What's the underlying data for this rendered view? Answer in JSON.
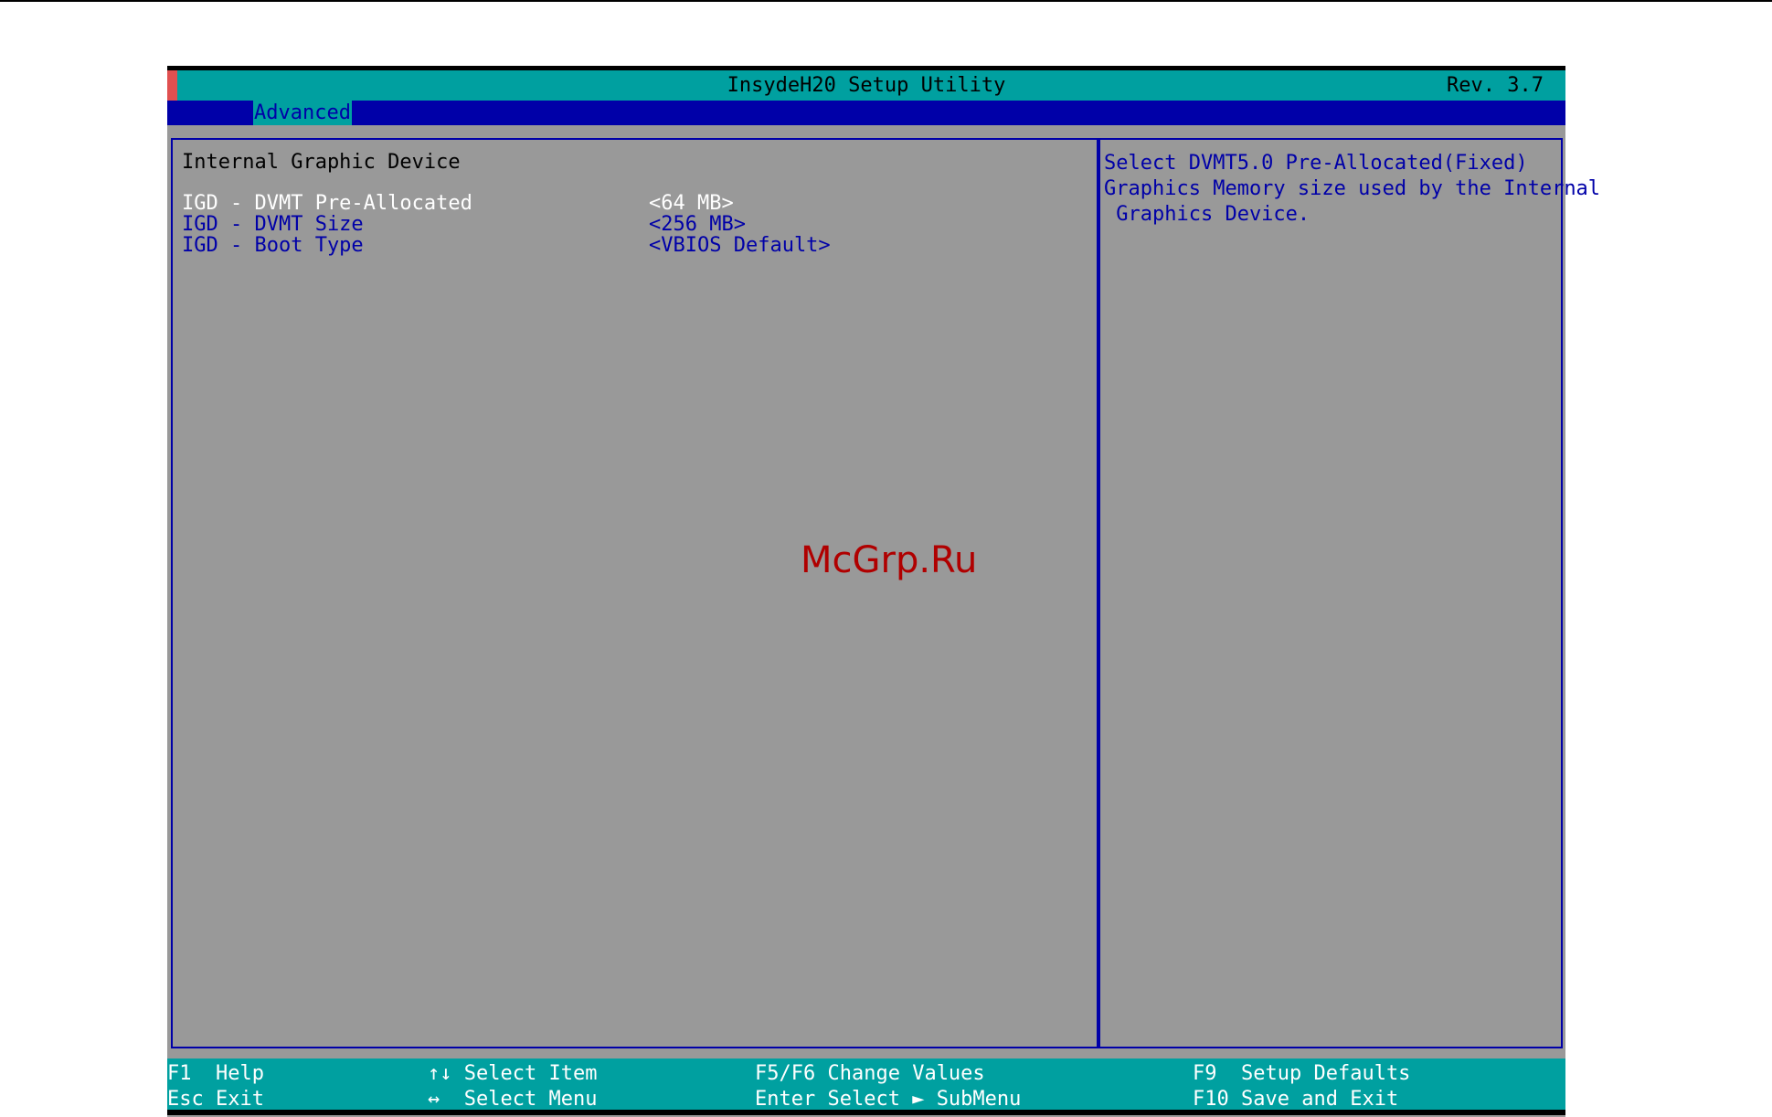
{
  "window": {
    "title": "InsydeH20 Setup Utility",
    "revision": "Rev. 3.7"
  },
  "menu": {
    "tabs": [
      {
        "label": "Advanced",
        "active": true
      }
    ]
  },
  "main": {
    "section_title": "Internal Graphic Device",
    "items": [
      {
        "label": "IGD - DVMT Pre-Allocated",
        "value": "<64 MB>",
        "selected": true
      },
      {
        "label": "IGD - DVMT Size",
        "value": "<256 MB>",
        "selected": false
      },
      {
        "label": "IGD - Boot Type",
        "value": "<VBIOS Default>",
        "selected": false
      }
    ]
  },
  "help": {
    "line1": "Select DVMT5.0 Pre-Allocated(Fixed)",
    "line2": "Graphics Memory size used by the Internal",
    "line3": " Graphics Device."
  },
  "footer": {
    "keys": [
      {
        "key": "F1",
        "desc": "Help"
      },
      {
        "key": "Esc",
        "desc": "Exit"
      },
      {
        "key": "↑↓",
        "desc": "Select Item"
      },
      {
        "key": "↔",
        "desc": "Select Menu"
      },
      {
        "key": "F5/F6",
        "desc": "Change Values"
      },
      {
        "key": "Enter",
        "desc": "Select ► SubMenu"
      },
      {
        "key": "F9",
        "desc": "Setup Defaults"
      },
      {
        "key": "F10",
        "desc": "Save and Exit"
      }
    ]
  },
  "watermark": "McGrp.Ru",
  "colors": {
    "background": "#999999",
    "bar": "#00a0a0",
    "menu": "#0000a8",
    "selected_text": "#ffffff",
    "item_text": "#0000a8"
  }
}
